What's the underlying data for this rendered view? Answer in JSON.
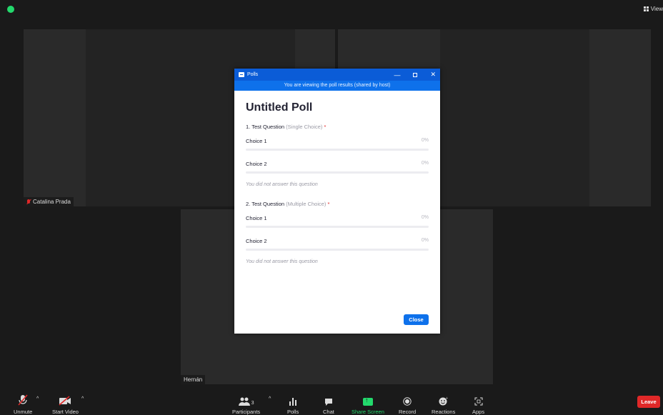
{
  "top_bar": {
    "view_label": "View"
  },
  "participants": [
    {
      "name": "Catalina Prada",
      "muted": true
    },
    {
      "name": "Hernán",
      "muted": false
    }
  ],
  "poll_window": {
    "title": "Polls",
    "banner": "You are viewing the poll results (shared by host)",
    "poll_title": "Untitled Poll",
    "questions": [
      {
        "number_label": "1. Test Question",
        "type": "(Single Choice)",
        "required_mark": "*",
        "choices": [
          {
            "label": "Choice 1",
            "percent": "0%",
            "fill": 0
          },
          {
            "label": "Choice 2",
            "percent": "0%",
            "fill": 0
          }
        ],
        "note": "You did not answer this question"
      },
      {
        "number_label": "2. Test Question",
        "type": "(Multiple Choice)",
        "required_mark": "*",
        "choices": [
          {
            "label": "Choice 1",
            "percent": "0%",
            "fill": 0
          },
          {
            "label": "Choice 2",
            "percent": "0%",
            "fill": 0
          }
        ],
        "note": "You did not answer this question"
      }
    ],
    "close_label": "Close",
    "window_controls": {
      "minimize": "—",
      "close": "✕"
    }
  },
  "toolbar": {
    "unmute": "Unmute",
    "start_video": "Start Video",
    "participants": "Participants",
    "participant_count": "3",
    "polls": "Polls",
    "chat": "Chat",
    "share_screen": "Share Screen",
    "record": "Record",
    "reactions": "Reactions",
    "apps": "Apps",
    "leave": "Leave"
  },
  "colors": {
    "accent": "#0e71eb",
    "titlebar": "#0b5cd7",
    "leave": "#e02828",
    "share": "#23d96c"
  }
}
